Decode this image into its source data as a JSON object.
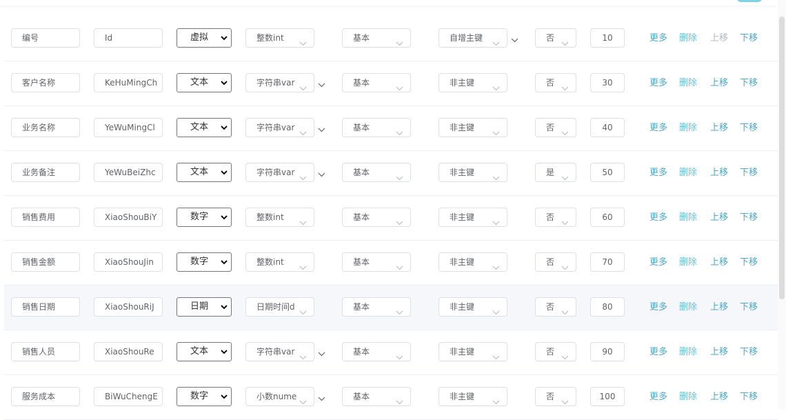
{
  "actions": {
    "more": "更多",
    "delete": "删除",
    "up": "上移",
    "down": "下移"
  },
  "rows": [
    {
      "name": "编号",
      "field": "Id",
      "type": "虚拟",
      "dtype": "整数int",
      "dtype_chevron": false,
      "category": "基本",
      "pk": "自增主键",
      "pk_chevron": true,
      "nullable": "否",
      "length": "10",
      "up_disabled": true
    },
    {
      "name": "客户名称",
      "field": "KeHuMingCh",
      "type": "文本",
      "dtype": "字符串var",
      "dtype_chevron": true,
      "category": "基本",
      "pk": "非主键",
      "pk_chevron": false,
      "nullable": "否",
      "length": "30",
      "up_disabled": false
    },
    {
      "name": "业务名称",
      "field": "YeWuMingCl",
      "type": "文本",
      "dtype": "字符串var",
      "dtype_chevron": true,
      "category": "基本",
      "pk": "非主键",
      "pk_chevron": false,
      "nullable": "否",
      "length": "40",
      "up_disabled": false
    },
    {
      "name": "业务备注",
      "field": "YeWuBeiZhc",
      "type": "文本",
      "dtype": "字符串var",
      "dtype_chevron": true,
      "category": "基本",
      "pk": "非主键",
      "pk_chevron": false,
      "nullable": "是",
      "length": "50",
      "up_disabled": false
    },
    {
      "name": "销售费用",
      "field": "XiaoShouBiY",
      "type": "数字",
      "dtype": "整数int",
      "dtype_chevron": false,
      "category": "基本",
      "pk": "非主键",
      "pk_chevron": false,
      "nullable": "否",
      "length": "60",
      "up_disabled": false
    },
    {
      "name": "销售金额",
      "field": "XiaoShouJin",
      "type": "数字",
      "dtype": "整数int",
      "dtype_chevron": false,
      "category": "基本",
      "pk": "非主键",
      "pk_chevron": false,
      "nullable": "否",
      "length": "70",
      "up_disabled": false
    },
    {
      "name": "销售日期",
      "field": "XiaoShouRiJ",
      "type": "日期",
      "dtype": "日期时间d",
      "dtype_chevron": false,
      "category": "基本",
      "pk": "非主键",
      "pk_chevron": false,
      "nullable": "否",
      "length": "80",
      "up_disabled": false,
      "hover": true
    },
    {
      "name": "销售人员",
      "field": "XiaoShouRe",
      "type": "文本",
      "dtype": "字符串var",
      "dtype_chevron": true,
      "category": "基本",
      "pk": "非主键",
      "pk_chevron": false,
      "nullable": "否",
      "length": "90",
      "up_disabled": false
    },
    {
      "name": "服务成本",
      "field": "BiWuChengE",
      "type": "数字",
      "dtype": "小数nume",
      "dtype_chevron": true,
      "category": "基本",
      "pk": "非主键",
      "pk_chevron": false,
      "nullable": "否",
      "length": "100",
      "up_disabled": false
    }
  ]
}
